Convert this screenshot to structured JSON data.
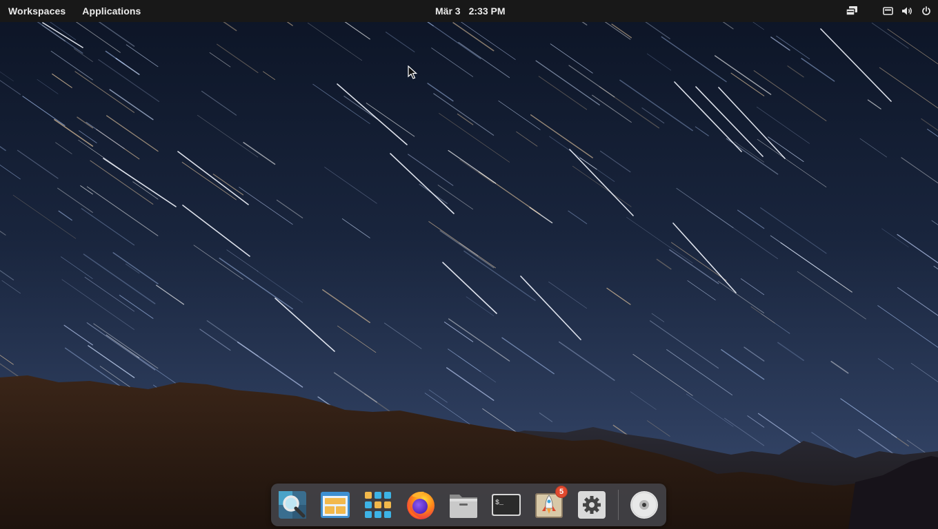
{
  "topbar": {
    "workspaces_label": "Workspaces",
    "applications_label": "Applications",
    "date": "Mär 3",
    "time": "2:33 PM",
    "tray_icons": [
      "multitasking-view-icon",
      "keyboard-icon",
      "volume-icon",
      "power-icon"
    ]
  },
  "dock": {
    "items": [
      {
        "name": "search-app",
        "icon": "magnifier-icon"
      },
      {
        "name": "multitasking-view",
        "icon": "windows-icon"
      },
      {
        "name": "app-grid",
        "icon": "grid-icon"
      },
      {
        "name": "firefox",
        "icon": "firefox-icon"
      },
      {
        "name": "files",
        "icon": "folder-icon"
      },
      {
        "name": "terminal",
        "icon": "terminal-icon",
        "prompt": "$_"
      },
      {
        "name": "appcenter",
        "icon": "rocket-icon",
        "badge": "5"
      },
      {
        "name": "system-settings",
        "icon": "gear-icon"
      },
      {
        "name": "optical-disc",
        "icon": "disc-icon"
      }
    ]
  },
  "colors": {
    "panel": "#181818",
    "sky_top": "#0c1425",
    "sky_bottom": "#35476a",
    "mountains": "#2e1d15",
    "badge": "#e24a2f"
  }
}
